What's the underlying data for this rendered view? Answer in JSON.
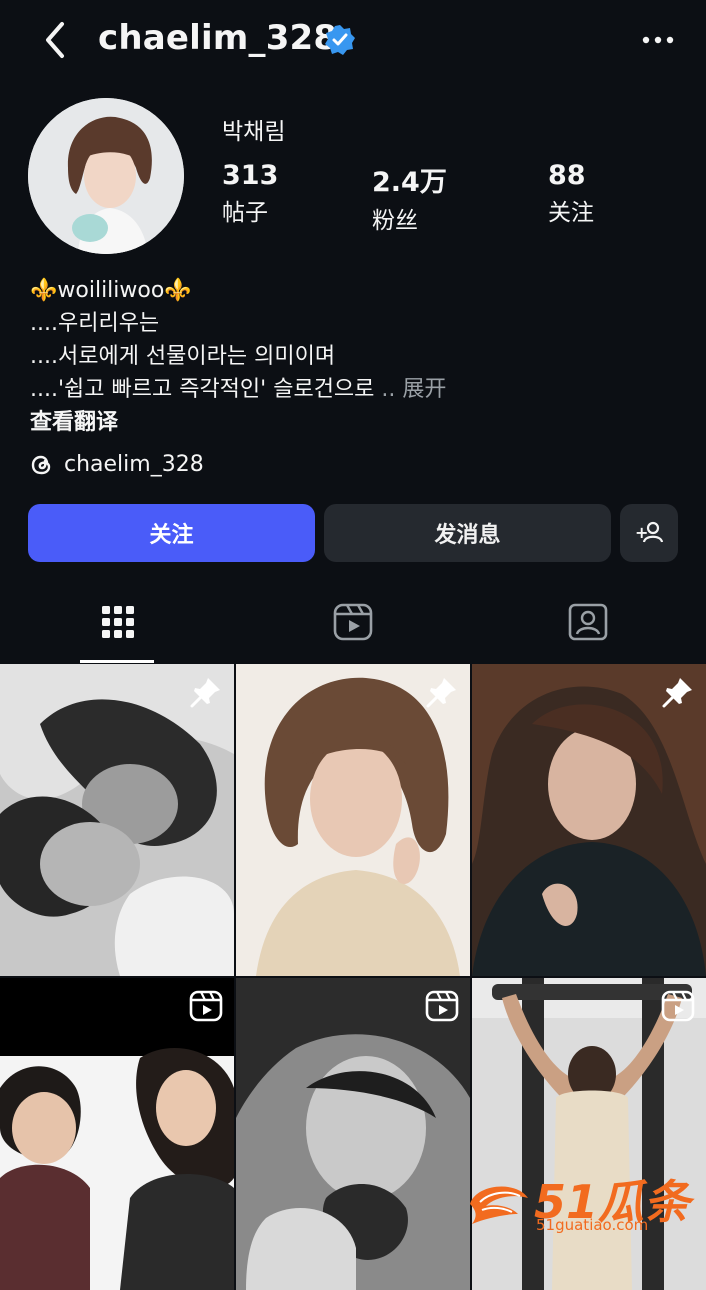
{
  "header": {
    "username": "chaelim_328",
    "verified_icon": "verified-badge-icon",
    "more_icon": "more-dots-icon",
    "back_icon": "back-chevron-icon"
  },
  "profile": {
    "display_name": "박채림",
    "stats": [
      {
        "value": "313",
        "label": "帖子"
      },
      {
        "value": "2.4万",
        "label": "粉丝"
      },
      {
        "value": "88",
        "label": "关注"
      }
    ]
  },
  "bio": {
    "line1": "⚜️woililiwoo⚜️",
    "line2": "....우리리우는",
    "line3": "....서로에게 선물이라는 의미이며",
    "line4": "....'쉽고 빠르고 즉각적인' 슬로건으로",
    "ellipsis": " ..",
    "expand": "展开",
    "translate": "查看翻译",
    "threads_handle": "chaelim_328"
  },
  "actions": {
    "follow": "关注",
    "message": "发消息"
  },
  "tabs": [
    "posts-grid-tab",
    "reels-tab",
    "tagged-tab"
  ],
  "colors": {
    "background": "#0c0f14",
    "follow_button": "#4a5cf9",
    "secondary_button": "#25292f",
    "verified": "#3897f0",
    "watermark": "#f26b1f"
  },
  "watermark": {
    "brand": "51瓜条",
    "domain": "51guatiao.com"
  }
}
